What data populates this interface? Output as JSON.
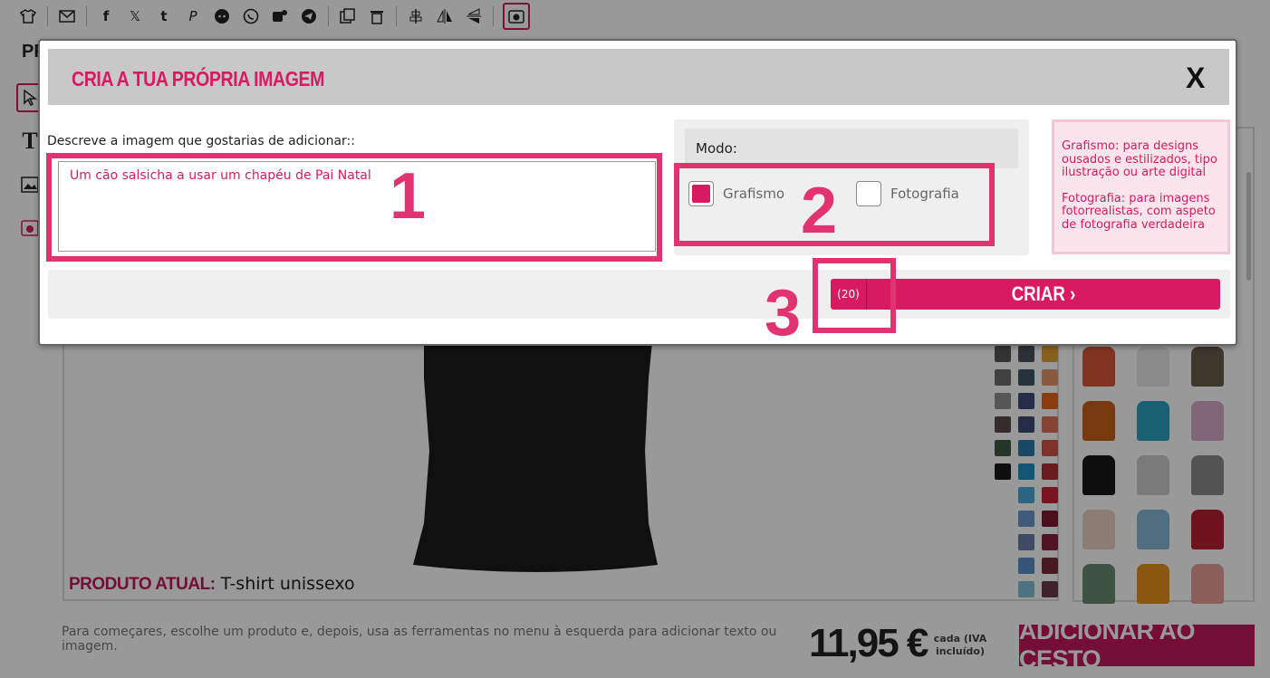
{
  "toolbar": {
    "icons": [
      "tshirt-icon",
      "email-icon",
      "facebook-icon",
      "x-icon",
      "tumblr-icon",
      "pinterest-icon",
      "reddit-icon",
      "whatsapp-icon",
      "teams-icon",
      "telegram-icon",
      "copy-icon",
      "trash-icon",
      "align-center-icon",
      "flip-horizontal-icon",
      "flip-vertical-icon",
      "ai-image-icon"
    ],
    "glyphs": {
      "facebook": "f",
      "x": "𝕏",
      "tumblr": "t",
      "pinterest": "P"
    }
  },
  "page": {
    "title_fragment": "PR",
    "current_product_label": "PRODUTO ATUAL:",
    "current_product_value": "T-shirt unissexo",
    "hint": "Para começares, escolhe um produto e, depois, usa as ferramentas no menu à esquerda para adicionar texto ou imagem.",
    "price": "11,95 €",
    "price_note": "cada (IVA incluído)",
    "add_to_cart": "ADICIONAR AO CESTO"
  },
  "colors": {
    "accent": "#d81b60",
    "annotation": "#e0336f",
    "swatches": [
      "#555555",
      "#4a5060",
      "#e0a030",
      "#6d6d6d",
      "#3c5565",
      "#e6956a",
      "#909090",
      "#3e4c7a",
      "#e8641a",
      "#5a4a48",
      "#404a70",
      "#e07058",
      "#3e5a40",
      "#2a7aa8",
      "#d65040",
      "#1a1a1a",
      "#2090c0",
      "#b03030",
      "",
      "#4aa8d8",
      "#c8203a",
      "",
      "#6a98c8",
      "#7a1a30",
      "",
      "#6a7ea8",
      "#8a2040",
      "",
      "#5a8ec8",
      "#7a2a3a",
      "",
      "#80c0d8",
      "#6a3a4a"
    ],
    "product_thumbs": [
      "#d9553a",
      "#e8e8e8",
      "#6a5a4a",
      "#c8601a",
      "#2aa0c0",
      "#d8a8c8",
      "#1a1a1a",
      "#cccccc",
      "#8a8a8a",
      "#e8d0c0",
      "#88b8d8",
      "#b82030",
      "#6a8a70",
      "#e8901a",
      "#e8a098"
    ]
  },
  "modal": {
    "title": "CRIA A TUA PRÓPRIA IMAGEM",
    "close": "X",
    "description_label": "Descreve a imagem que gostarias de adicionar::",
    "description_value": "Um cão salsicha a usar um chapéu de Pai Natal",
    "mode_label": "Modo:",
    "options": [
      {
        "label": "Grafismo",
        "checked": true
      },
      {
        "label": "Fotografia",
        "checked": false
      }
    ],
    "info": [
      "Grafismo: para designs ousados e estilizados, tipo ilustração ou arte digital",
      "Fotografia: para imagens fotorrealistas, com aspeto de fotografia verdadeira"
    ],
    "credits": "(20)",
    "create_label": "CRIAR ›"
  },
  "annotations": [
    "1",
    "2",
    "3"
  ]
}
